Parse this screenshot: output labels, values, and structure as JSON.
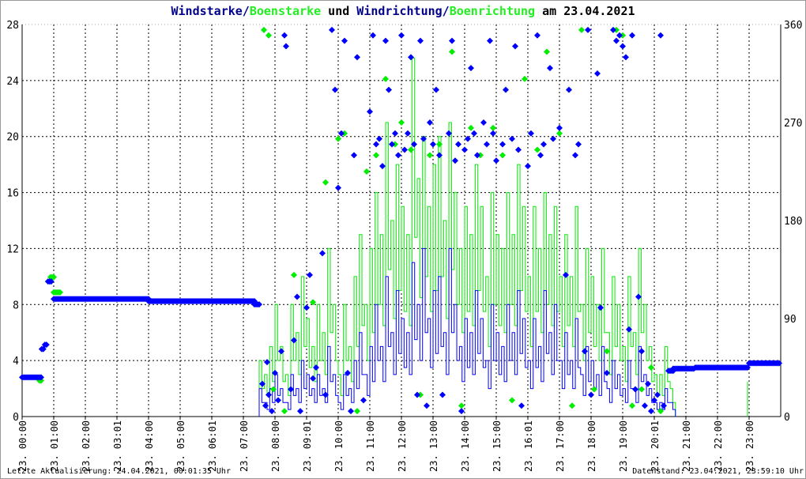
{
  "title": {
    "part1": "Windstarke",
    "sep1": "/",
    "part2": "Boenstarke",
    "mid": " und ",
    "part3": "Windrichtung",
    "sep2": "/",
    "part4": "Boenrichtung",
    "tail": " am 23.04.2021"
  },
  "footer": {
    "left": "Letzte Aktualisierung: 24.04.2021, 00:01:35 Uhr",
    "right": "Datenstand: 23.04.2021, 23:59:10 Uhr"
  },
  "colors": {
    "speed": "#0000ff",
    "gust": "#00ee00",
    "title_dark": "#00008b"
  },
  "chart_data": {
    "type": "line",
    "title": "Windstarke/Boenstarke und Windrichtung/Boenrichtung am 23.04.2021",
    "x_range_hours": [
      0,
      24
    ],
    "ylim_left": [
      0,
      28
    ],
    "ylim_right": [
      0,
      360
    ],
    "yticks_left": [
      0,
      4,
      8,
      12,
      16,
      20,
      24,
      28
    ],
    "yticks_right": [
      0,
      90,
      180,
      270,
      360
    ],
    "xtick_labels": [
      "23. 00:00",
      "23. 01:00",
      "23. 02:00",
      "23. 03:01",
      "23. 04:00",
      "23. 05:00",
      "23. 06:01",
      "23. 07:00",
      "23. 08:00",
      "23. 09:01",
      "23. 10:00",
      "23. 11:00",
      "23. 12:00",
      "23. 13:00",
      "23. 14:00",
      "23. 15:00",
      "23. 16:01",
      "23. 17:00",
      "23. 18:00",
      "23. 19:00",
      "23. 20:01",
      "23. 21:00",
      "23. 22:00",
      "23. 23:00"
    ],
    "grid": true,
    "series_speed": {
      "name": "Windstarke",
      "start_hour": 7.5,
      "step_hours": 0.1667,
      "values": [
        2,
        1,
        2,
        3,
        2,
        1,
        3,
        2,
        4,
        3,
        2,
        3,
        2,
        5,
        3,
        1,
        3,
        2,
        4,
        6,
        3,
        5,
        8,
        5,
        10,
        6,
        9,
        7,
        6,
        11,
        8,
        12,
        7,
        9,
        10,
        6,
        12,
        8,
        5,
        7,
        6,
        9,
        7,
        4,
        8,
        6,
        5,
        8,
        6,
        9,
        7,
        4,
        7,
        5,
        9,
        6,
        8,
        4,
        6,
        4,
        7,
        3,
        5,
        4,
        3,
        5,
        2,
        4,
        3,
        2,
        4,
        2,
        5,
        3,
        2,
        1,
        1,
        2,
        1
      ]
    },
    "series_gust": {
      "name": "Boenstarke",
      "start_hour": 7.5,
      "step_hours": 0.1667,
      "values": [
        4,
        3,
        5,
        8,
        5,
        3,
        8,
        6,
        10,
        7,
        5,
        8,
        6,
        12,
        8,
        3,
        8,
        5,
        10,
        13,
        8,
        12,
        16,
        13,
        21,
        14,
        18,
        15,
        13,
        25.6,
        17,
        20,
        15,
        18,
        20,
        14,
        21,
        16,
        12,
        15,
        13,
        18,
        15,
        10,
        16,
        13,
        12,
        16,
        13,
        18,
        15,
        10,
        15,
        12,
        16,
        13,
        15,
        10,
        13,
        10,
        15,
        8,
        12,
        10,
        8,
        12,
        6,
        10,
        8,
        5,
        10,
        6,
        12,
        8,
        5,
        3,
        3,
        5,
        2
      ],
      "extra": [
        [
          22.95,
          2.5
        ]
      ]
    },
    "direction_wind_segments": [
      [
        0,
        0.6,
        36
      ],
      [
        0.62,
        0.7,
        62
      ],
      [
        0.72,
        0.8,
        66
      ],
      [
        0.82,
        0.95,
        124
      ],
      [
        1.0,
        4.0,
        108
      ],
      [
        4.0,
        7.35,
        106
      ],
      [
        7.35,
        7.5,
        103
      ],
      [
        20.45,
        20.6,
        42
      ],
      [
        20.6,
        21.3,
        44
      ],
      [
        21.3,
        23.0,
        45
      ],
      [
        23.0,
        24.0,
        49
      ]
    ],
    "direction_gust_segments": [
      [
        0.55,
        0.65,
        33
      ],
      [
        0.9,
        1.0,
        128
      ],
      [
        1.0,
        1.25,
        114
      ]
    ],
    "direction_wind": [
      [
        7.6,
        30
      ],
      [
        7.7,
        10
      ],
      [
        7.75,
        50
      ],
      [
        7.8,
        20
      ],
      [
        7.9,
        5
      ],
      [
        8.0,
        40
      ],
      [
        8.1,
        15
      ],
      [
        8.2,
        60
      ],
      [
        8.3,
        350
      ],
      [
        8.35,
        340
      ],
      [
        8.5,
        25
      ],
      [
        8.6,
        70
      ],
      [
        8.7,
        110
      ],
      [
        8.8,
        5
      ],
      [
        9.0,
        100
      ],
      [
        9.1,
        130
      ],
      [
        9.2,
        35
      ],
      [
        9.3,
        45
      ],
      [
        9.5,
        150
      ],
      [
        9.6,
        20
      ],
      [
        9.8,
        355
      ],
      [
        9.9,
        300
      ],
      [
        10.0,
        210
      ],
      [
        10.1,
        260
      ],
      [
        10.2,
        345
      ],
      [
        10.3,
        40
      ],
      [
        10.4,
        5
      ],
      [
        10.5,
        240
      ],
      [
        10.6,
        330
      ],
      [
        10.8,
        15
      ],
      [
        11.0,
        280
      ],
      [
        11.1,
        350
      ],
      [
        11.2,
        250
      ],
      [
        11.3,
        255
      ],
      [
        11.4,
        230
      ],
      [
        11.5,
        345
      ],
      [
        11.6,
        300
      ],
      [
        11.7,
        250
      ],
      [
        11.8,
        260
      ],
      [
        11.9,
        240
      ],
      [
        12.0,
        350
      ],
      [
        12.1,
        245
      ],
      [
        12.2,
        260
      ],
      [
        12.3,
        330
      ],
      [
        12.4,
        250
      ],
      [
        12.5,
        20
      ],
      [
        12.6,
        345
      ],
      [
        12.7,
        255
      ],
      [
        12.8,
        10
      ],
      [
        12.9,
        270
      ],
      [
        13.0,
        250
      ],
      [
        13.1,
        300
      ],
      [
        13.2,
        240
      ],
      [
        13.3,
        20
      ],
      [
        13.5,
        260
      ],
      [
        13.6,
        345
      ],
      [
        13.7,
        235
      ],
      [
        13.8,
        250
      ],
      [
        13.9,
        5
      ],
      [
        14.0,
        245
      ],
      [
        14.1,
        255
      ],
      [
        14.2,
        320
      ],
      [
        14.3,
        260
      ],
      [
        14.4,
        240
      ],
      [
        14.6,
        270
      ],
      [
        14.7,
        250
      ],
      [
        14.8,
        345
      ],
      [
        14.9,
        260
      ],
      [
        15.0,
        235
      ],
      [
        15.2,
        250
      ],
      [
        15.3,
        300
      ],
      [
        15.5,
        255
      ],
      [
        15.6,
        340
      ],
      [
        15.7,
        245
      ],
      [
        15.8,
        10
      ],
      [
        16.0,
        230
      ],
      [
        16.1,
        260
      ],
      [
        16.3,
        350
      ],
      [
        16.4,
        240
      ],
      [
        16.5,
        250
      ],
      [
        16.7,
        320
      ],
      [
        16.8,
        255
      ],
      [
        17.0,
        265
      ],
      [
        17.2,
        130
      ],
      [
        17.3,
        300
      ],
      [
        17.5,
        240
      ],
      [
        17.6,
        250
      ],
      [
        17.8,
        60
      ],
      [
        17.9,
        355
      ],
      [
        18.0,
        20
      ],
      [
        18.2,
        315
      ],
      [
        18.3,
        100
      ],
      [
        18.5,
        40
      ],
      [
        18.7,
        355
      ],
      [
        18.8,
        345
      ],
      [
        18.9,
        350
      ],
      [
        19.0,
        340
      ],
      [
        19.1,
        330
      ],
      [
        19.2,
        80
      ],
      [
        19.3,
        350
      ],
      [
        19.4,
        25
      ],
      [
        19.5,
        110
      ],
      [
        19.6,
        60
      ],
      [
        19.7,
        10
      ],
      [
        19.8,
        30
      ],
      [
        19.9,
        5
      ],
      [
        20.0,
        15
      ],
      [
        20.1,
        20
      ],
      [
        20.2,
        350
      ],
      [
        20.3,
        10
      ]
    ],
    "direction_gust": [
      [
        7.65,
        355
      ],
      [
        7.8,
        350
      ],
      [
        7.95,
        25
      ],
      [
        8.3,
        5
      ],
      [
        8.6,
        130
      ],
      [
        9.2,
        105
      ],
      [
        9.6,
        215
      ],
      [
        10.0,
        255
      ],
      [
        10.2,
        260
      ],
      [
        10.6,
        5
      ],
      [
        10.9,
        225
      ],
      [
        11.2,
        240
      ],
      [
        11.5,
        310
      ],
      [
        11.8,
        250
      ],
      [
        12.0,
        270
      ],
      [
        12.3,
        245
      ],
      [
        12.6,
        20
      ],
      [
        12.9,
        240
      ],
      [
        13.2,
        250
      ],
      [
        13.6,
        335
      ],
      [
        13.9,
        10
      ],
      [
        14.2,
        265
      ],
      [
        14.5,
        240
      ],
      [
        14.9,
        265
      ],
      [
        15.2,
        240
      ],
      [
        15.5,
        15
      ],
      [
        15.9,
        310
      ],
      [
        16.3,
        245
      ],
      [
        16.6,
        335
      ],
      [
        17.0,
        260
      ],
      [
        17.4,
        10
      ],
      [
        17.7,
        355
      ],
      [
        18.1,
        25
      ],
      [
        18.5,
        60
      ],
      [
        18.8,
        355
      ],
      [
        19.0,
        350
      ],
      [
        19.3,
        10
      ],
      [
        19.6,
        25
      ],
      [
        19.9,
        45
      ],
      [
        20.2,
        5
      ]
    ]
  }
}
